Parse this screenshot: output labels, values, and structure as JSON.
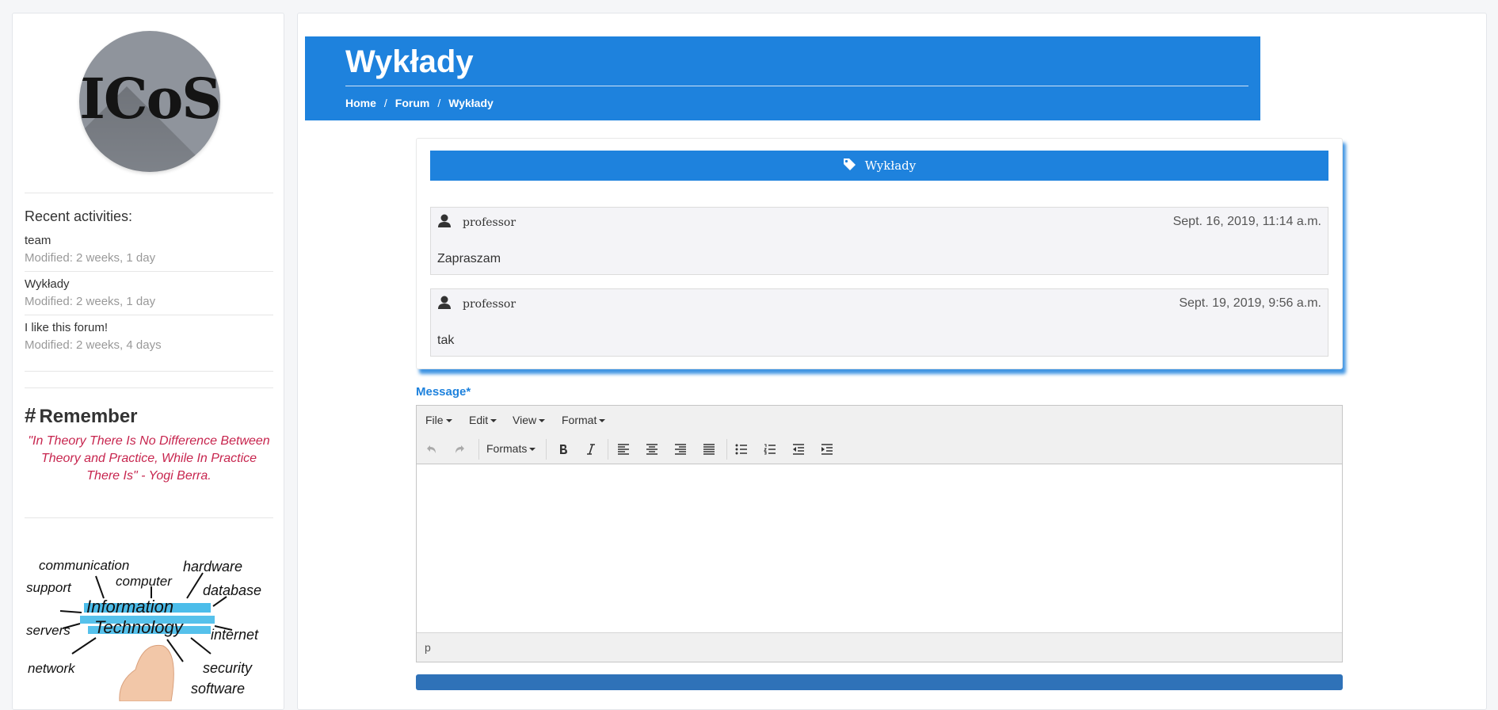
{
  "sidebar": {
    "logo_text": "ICoS",
    "recent_title": "Recent activities:",
    "activities": [
      {
        "name": "team",
        "modified": "Modified: 2 weeks, 1 day"
      },
      {
        "name": "Wykłady",
        "modified": "Modified: 2 weeks, 1 day"
      },
      {
        "name": "I like this forum!",
        "modified": "Modified: 2 weeks, 4 days"
      }
    ],
    "remember_hash": "#",
    "remember_title": "Remember",
    "quote": "\"In Theory There Is No Difference Between Theory and Practice, While In Practice There Is\" - Yogi Berra.",
    "it_words": [
      "communication",
      "hardware",
      "support",
      "computer",
      "database",
      "Information",
      "Technology",
      "servers",
      "internet",
      "network",
      "security",
      "software"
    ]
  },
  "header": {
    "title": "Wykłady",
    "breadcrumb": [
      "Home",
      "Forum",
      "Wykłady"
    ],
    "separator": "/"
  },
  "thread": {
    "tag": "Wykłady",
    "posts": [
      {
        "author": "professor",
        "date": "Sept. 16, 2019, 11:14 a.m.",
        "body": "Zapraszam"
      },
      {
        "author": "professor",
        "date": "Sept. 19, 2019, 9:56 a.m.",
        "body": "tak"
      }
    ]
  },
  "editor": {
    "label": "Message*",
    "menu": [
      "File",
      "Edit",
      "View",
      "Format"
    ],
    "formats_label": "Formats",
    "status_path": "p"
  },
  "colors": {
    "primary": "#1e82dd",
    "quote": "#c7254e",
    "submit": "#2f72b8"
  }
}
